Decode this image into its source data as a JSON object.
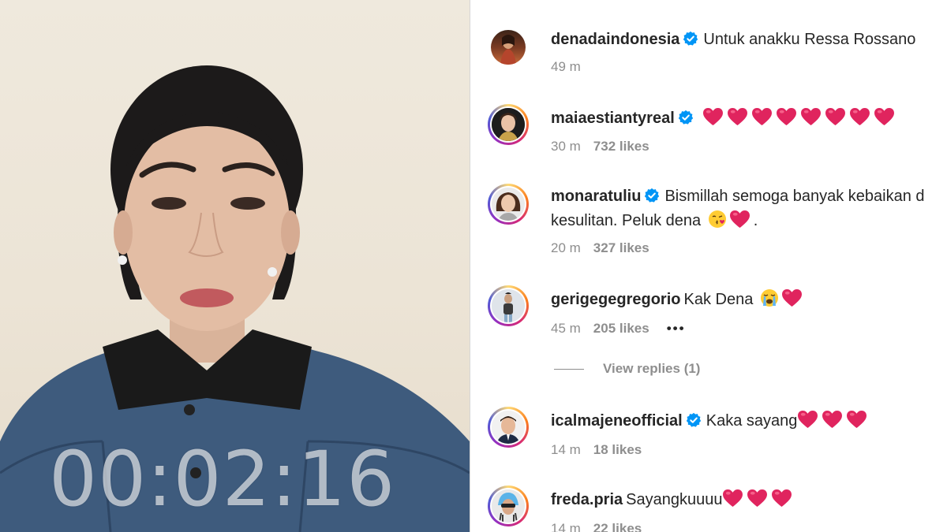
{
  "video": {
    "timer": "00:02:16"
  },
  "comments": [
    {
      "username": "denadaindonesia",
      "verified": true,
      "text": "Untuk anakku Ressa Rossano",
      "time": "49 m",
      "likes": "",
      "has_story_ring": false
    },
    {
      "username": "maiaestiantyreal",
      "verified": true,
      "text": "",
      "hearts": 8,
      "time": "30 m",
      "likes": "732 likes",
      "has_story_ring": true
    },
    {
      "username": "monaratuliu",
      "verified": true,
      "text": "Bismillah semoga banyak kebaikan d",
      "text_line2": "kesulitan. Peluk dena",
      "emoji_line2": [
        "kissing-face-emoji",
        "red-heart-emoji"
      ],
      "suffix": ".",
      "time": "20 m",
      "likes": "327 likes",
      "has_story_ring": true
    },
    {
      "username": "gerigegegregorio",
      "verified": false,
      "text": "Kak Dena",
      "emoji": [
        "crying-face-emoji",
        "red-heart-emoji"
      ],
      "time": "45 m",
      "likes": "205 likes",
      "more": "•••",
      "has_story_ring": true
    },
    {
      "username": "icalmajeneofficial",
      "verified": true,
      "text": "Kaka sayang",
      "hearts": 3,
      "time": "14 m",
      "likes": "18 likes",
      "has_story_ring": true
    },
    {
      "username": "freda.pria",
      "verified": false,
      "text": "Sayangkuuuu",
      "hearts": 3,
      "time": "14 m",
      "likes": "22 likes",
      "has_story_ring": true
    }
  ],
  "view_replies": "View replies (1)",
  "colors": {
    "heart": "#e0245e",
    "verified": "#0095f6",
    "meta": "#8e8e8e",
    "text": "#262626"
  }
}
